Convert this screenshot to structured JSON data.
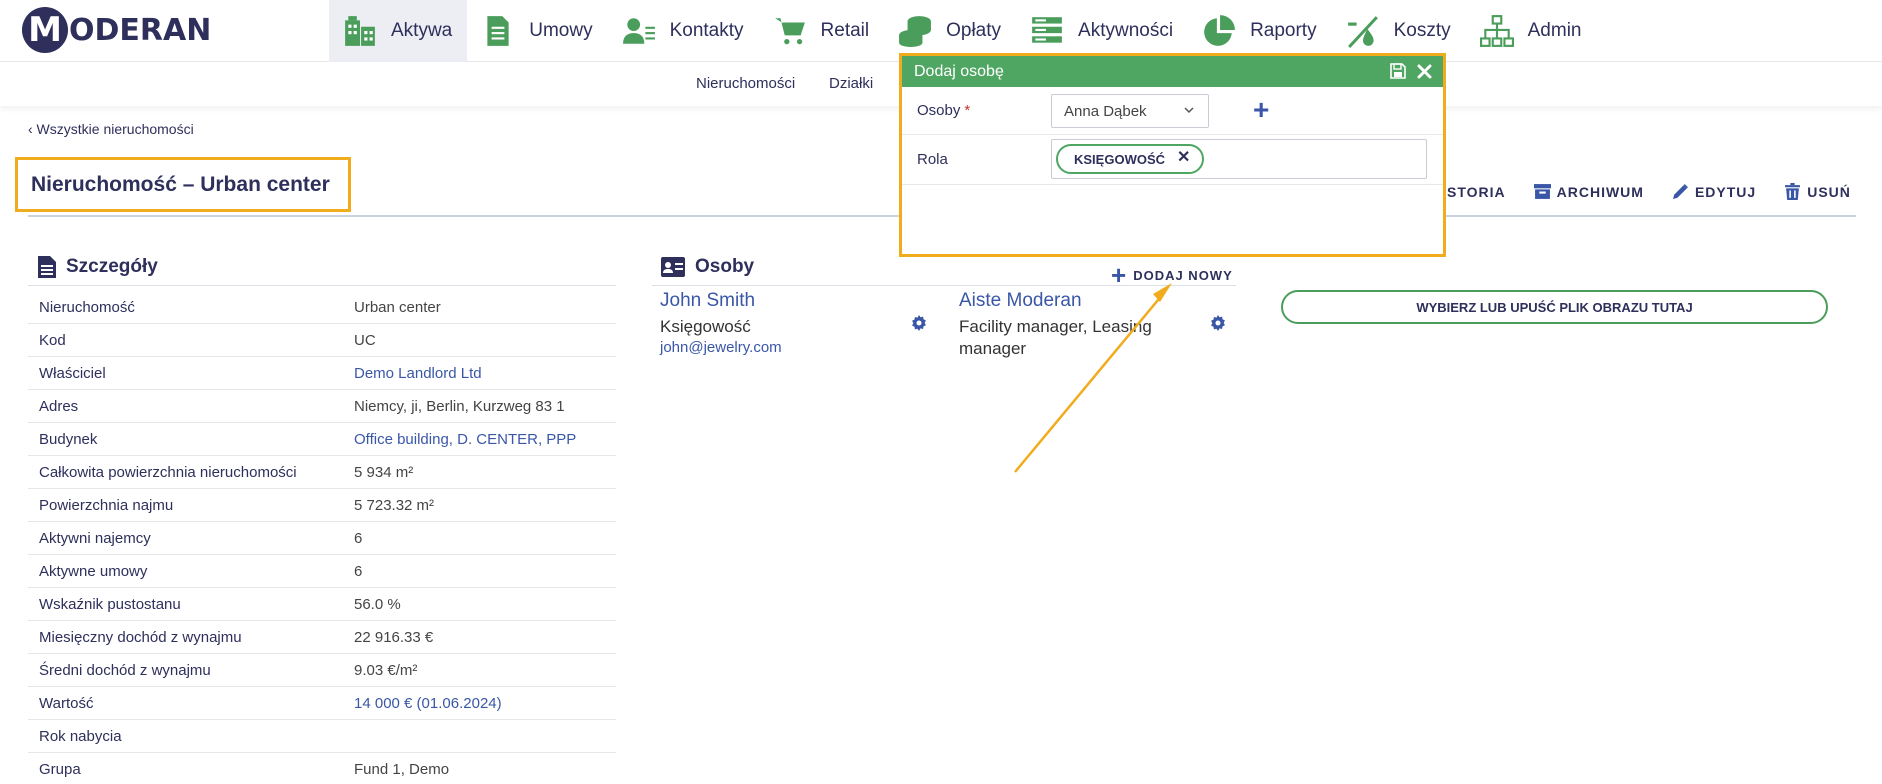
{
  "brand": {
    "logo_letter": "M",
    "logo_text": "ODERAN"
  },
  "nav": {
    "items": [
      {
        "label": "Aktywa",
        "icon": "building-icon"
      },
      {
        "label": "Umowy",
        "icon": "document-icon"
      },
      {
        "label": "Kontakty",
        "icon": "contacts-icon"
      },
      {
        "label": "Retail",
        "icon": "cart-icon"
      },
      {
        "label": "Opłaty",
        "icon": "coins-icon"
      },
      {
        "label": "Aktywności",
        "icon": "list-icon"
      },
      {
        "label": "Raporty",
        "icon": "pie-chart-icon"
      },
      {
        "label": "Koszty",
        "icon": "costs-icon"
      },
      {
        "label": "Admin",
        "icon": "sitemap-icon"
      }
    ],
    "active_color": "#ededf4",
    "icon_color": "#4a9d5b"
  },
  "subnav": {
    "items": [
      "Nieruchomości",
      "Działki"
    ]
  },
  "back_link": "‹ Wszystkie nieruchomości",
  "page_title": "Nieruchomość – Urban center",
  "actions": {
    "history": "STORIA",
    "archive": "ARCHIWUM",
    "edit": "EDYTUJ",
    "delete": "USUŃ"
  },
  "details": {
    "title": "Szczegóły",
    "rows": [
      {
        "key": "Nieruchomość",
        "value": "Urban center",
        "link": false
      },
      {
        "key": "Kod",
        "value": "UC",
        "link": false
      },
      {
        "key": "Właściciel",
        "value": "Demo Landlord Ltd",
        "link": true
      },
      {
        "key": "Adres",
        "value": "Niemcy, ji, Berlin, Kurzweg 83 1",
        "link": false
      },
      {
        "key": "Budynek",
        "value": "Office building, D. CENTER, PPP",
        "link": true
      },
      {
        "key": "Całkowita powierzchnia nieruchomości",
        "value": "5 934 m²",
        "link": false
      },
      {
        "key": "Powierzchnia najmu",
        "value": "5 723.32 m²",
        "link": false
      },
      {
        "key": "Aktywni najemcy",
        "value": "6",
        "link": false
      },
      {
        "key": "Aktywne umowy",
        "value": "6",
        "link": false
      },
      {
        "key": "Wskaźnik pustostanu",
        "value": "56.0 %",
        "link": false
      },
      {
        "key": "Miesięczny dochód z wynajmu",
        "value": "22 916.33 €",
        "link": false
      },
      {
        "key": "Średni dochód z wynajmu",
        "value": "9.03 €/m²",
        "link": false
      },
      {
        "key": "Wartość",
        "value": "14 000 € (01.06.2024)",
        "link": true
      },
      {
        "key": "Rok nabycia",
        "value": "",
        "link": false
      },
      {
        "key": "Grupa",
        "value": "Fund 1, Demo",
        "link": false
      }
    ]
  },
  "people": {
    "title": "Osoby",
    "add_label": "DODAJ NOWY",
    "list": [
      {
        "name": "John Smith",
        "role": "Księgowość",
        "email": "john@jewelry.com"
      },
      {
        "name": "Aiste Moderan",
        "role": "Facility manager, Leasing manager",
        "email": ""
      }
    ]
  },
  "upload": {
    "label": "WYBIERZ LUB UPUŚĆ PLIK OBRAZU TUTAJ"
  },
  "modal": {
    "title": "Dodaj osobę",
    "people_label": "Osoby",
    "required_mark": "*",
    "people_value": "Anna Dąbek",
    "role_label": "Rola",
    "role_tag": "KSIĘGOWOŚĆ",
    "header_color": "#4fa663"
  },
  "highlight_color": "#f0ac1c"
}
